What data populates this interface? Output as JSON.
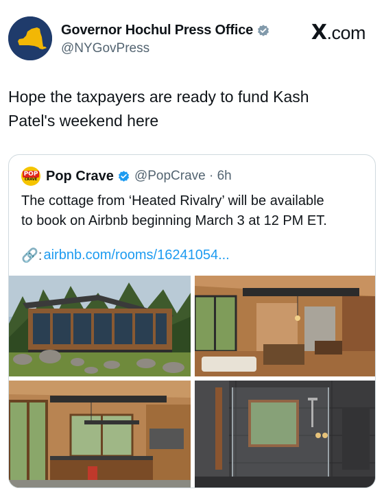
{
  "tweet": {
    "display_name": "Governor Hochul Press Office",
    "handle": "@NYGovPress",
    "source_mark": "X",
    "source_suffix": ".com",
    "line1": "Hope the taxpayers are ready to fund Kash",
    "line2": "Patel's weekend here"
  },
  "quote": {
    "avatar_top": "POP",
    "avatar_bottom": "CRAVE",
    "display_name": "Pop Crave",
    "handle_time": "@PopCrave · 6h",
    "line1": "The cottage from ‘Heated Rivalry’ will be available",
    "line2": "to book on Airbnb beginning March 3 at 12 PM ET.",
    "link_icon": "🔗:",
    "link_text": "airbnb.com/rooms/16241054..."
  },
  "icons": {
    "verified": "verified-badge-icon",
    "link": "link-icon"
  },
  "colors": {
    "text": "#0f1419",
    "secondary": "#536471",
    "link": "#1d9bf0",
    "verified": "#1d9bf0",
    "ny_avatar_bg": "#1f3b6b",
    "ny_state": "#f2b705",
    "pop_crave_yellow": "#f5c400"
  }
}
